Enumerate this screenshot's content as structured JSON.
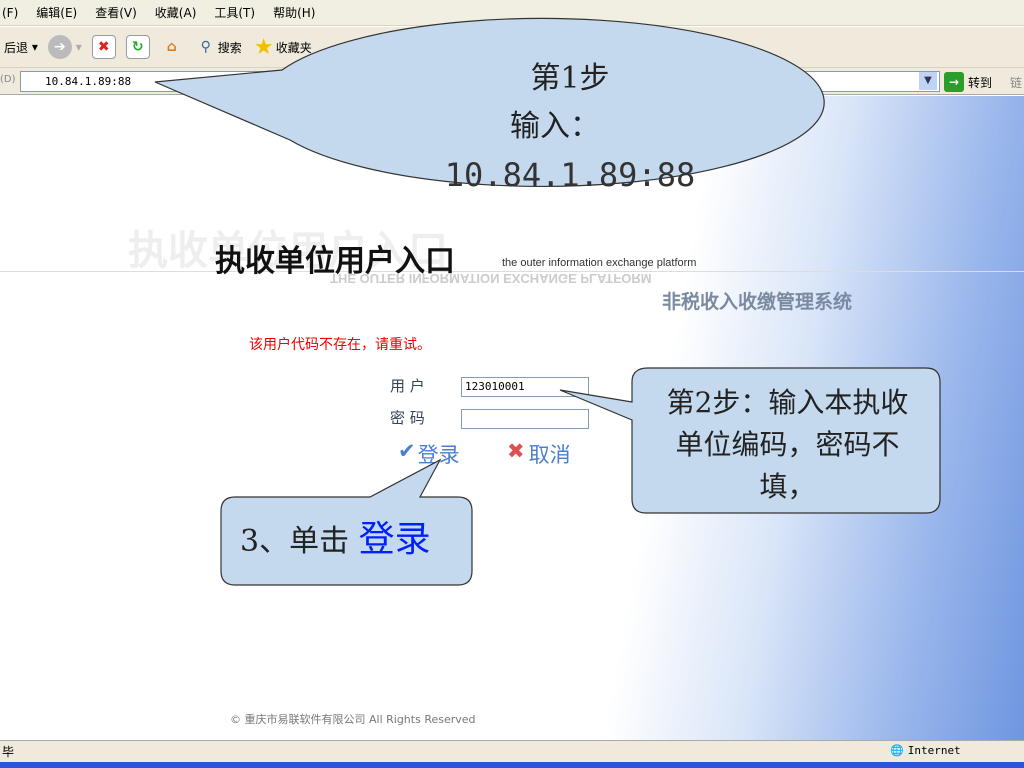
{
  "menu": [
    "(F)",
    "编辑(E)",
    "查看(V)",
    "收藏(A)",
    "工具(T)",
    "帮助(H)"
  ],
  "toolbar": {
    "back": "后退",
    "search": "搜索",
    "favorites": "收藏夹"
  },
  "address": {
    "label": "(D)",
    "value": "10.84.1.89:88",
    "go": "转到",
    "links": "链"
  },
  "page": {
    "title_watermark": "执收单位用户入口",
    "title": "执收单位用户入口",
    "subtitle_en": "the outer information exchange platform",
    "subtitle_en_mirror": "THE OUTER INFORMATION EXCHANGE PLATFORM",
    "system_name": "非税收入收缴管理系统",
    "error": "该用户代码不存在，请重试。",
    "user_label": "用 户",
    "user_value": "123010001",
    "pwd_label": "密 码",
    "login": "登录",
    "cancel": "取消",
    "footer": "© 重庆市易联软件有限公司  All Rights Reserved"
  },
  "callouts": {
    "step1_a": "第1步",
    "step1_b": "输入：",
    "step1_c": "10.84.1.89:88",
    "step2": "第2步：输入本执收单位编码，密码不填，",
    "step3_prefix": "3、单击 ",
    "step3_link": "登录"
  },
  "status": {
    "text": "毕",
    "zone": "Internet"
  }
}
